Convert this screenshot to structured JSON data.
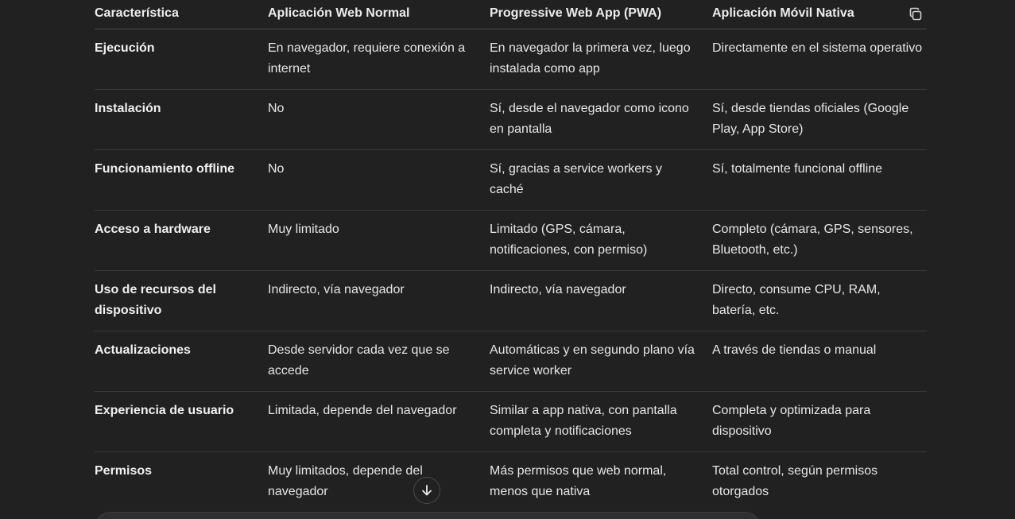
{
  "table": {
    "headers": [
      "Característica",
      "Aplicación Web Normal",
      "Progressive Web App (PWA)",
      "Aplicación Móvil Nativa"
    ],
    "rows": [
      [
        "Ejecución",
        "En navegador, requiere conexión a internet",
        "En navegador la primera vez, luego instalada como app",
        "Directamente en el sistema operativo"
      ],
      [
        "Instalación",
        "No",
        "Sí, desde el navegador como icono en pantalla",
        "Sí, desde tiendas oficiales (Google Play, App Store)"
      ],
      [
        "Funcionamiento offline",
        "No",
        "Sí, gracias a service workers y caché",
        "Sí, totalmente funcional offline"
      ],
      [
        "Acceso a hardware",
        "Muy limitado",
        "Limitado (GPS, cámara, notificaciones, con permiso)",
        "Completo (cámara, GPS, sensores, Bluetooth, etc.)"
      ],
      [
        "Uso de recursos del dispositivo",
        "Indirecto, vía navegador",
        "Indirecto, vía navegador",
        "Directo, consume CPU, RAM, batería, etc."
      ],
      [
        "Actualizaciones",
        "Desde servidor cada vez que se accede",
        "Automáticas y en segundo plano vía service worker",
        "A través de tiendas o manual"
      ],
      [
        "Experiencia de usuario",
        "Limitada, depende del navegador",
        "Similar a app nativa, con pantalla completa y notificaciones",
        "Completa y optimizada para dispositivo"
      ],
      [
        "Permisos",
        "Muy limitados, depende del navegador",
        "Más permisos que web normal, menos que nativa",
        "Total control, según permisos otorgados"
      ]
    ]
  },
  "icons": {
    "copy": "copy-icon",
    "scroll_down": "arrow-down-icon"
  },
  "colors": {
    "background": "#212121",
    "text": "#ececec",
    "divider": "#3a3a3a"
  }
}
